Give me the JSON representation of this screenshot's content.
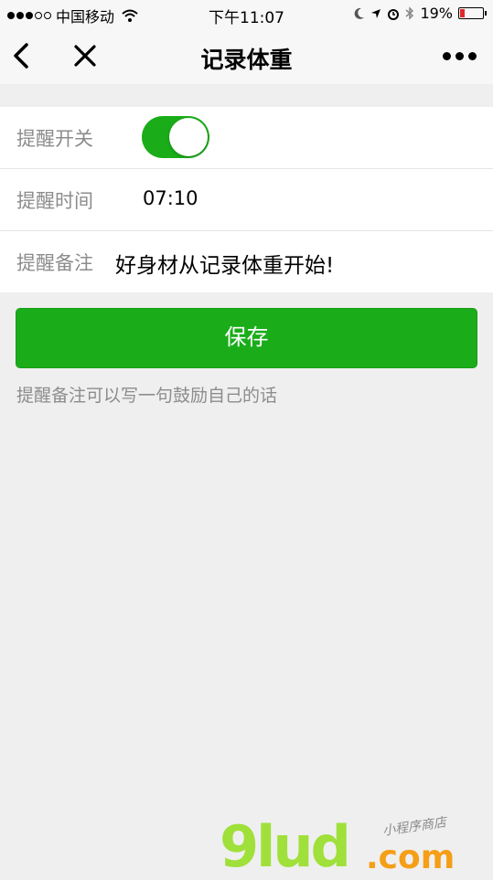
{
  "status_bar": {
    "carrier": "中国移动",
    "time": "下午11:07",
    "battery": "19%",
    "battery_level": 0.19,
    "battery_color": "#e0262b"
  },
  "nav": {
    "title": "记录体重",
    "back_icon": "chevron-left-icon",
    "close_icon": "close-icon",
    "more_icon": "more-dots-icon"
  },
  "settings": {
    "reminder_switch": {
      "label": "提醒开关",
      "on": true
    },
    "reminder_time": {
      "label": "提醒时间",
      "value": "07:10"
    },
    "reminder_note": {
      "label": "提醒备注",
      "value": "好身材从记录体重开始!"
    }
  },
  "save_button": {
    "label": "保存"
  },
  "tip": "提醒备注可以写一句鼓励自己的话",
  "watermark": {
    "brand": "9lud",
    "domain": ".com",
    "sub": "小程序商店"
  },
  "colors": {
    "accent": "#1aad19",
    "background": "#efefef"
  }
}
